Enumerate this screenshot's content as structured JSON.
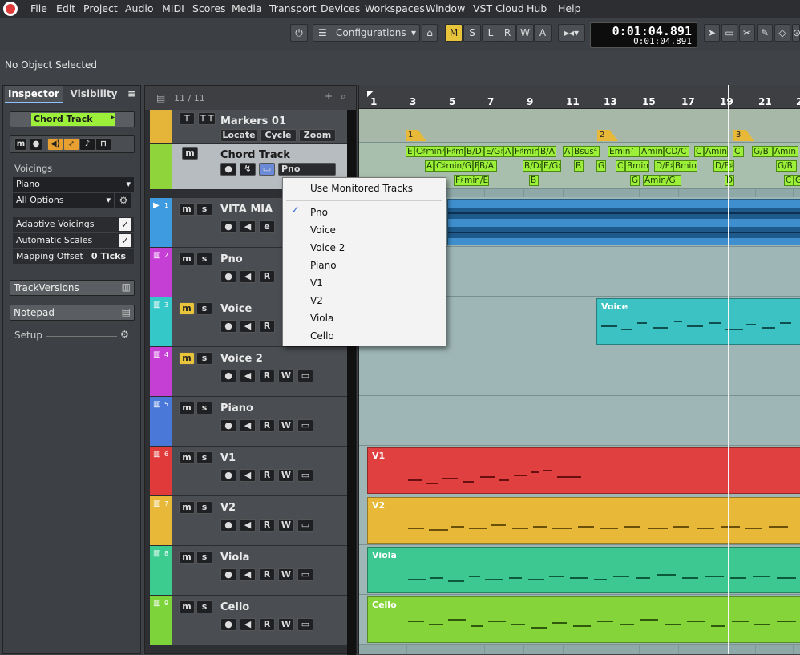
{
  "menubar": {
    "items": [
      "File",
      "Edit",
      "Project",
      "Audio",
      "MIDI",
      "Scores",
      "Media",
      "Transport",
      "Devices",
      "Workspaces",
      "Window",
      "VST Cloud",
      "Hub",
      "Help"
    ]
  },
  "toolbar": {
    "configurations_label": "Configurations",
    "mode_buttons": [
      "M",
      "S",
      "L",
      "R",
      "W",
      "A"
    ],
    "time_primary": "0:01:04.891",
    "time_secondary": "0:01:04.891"
  },
  "infoline": {
    "text": "No Object Selected"
  },
  "inspector": {
    "tabs": [
      "Inspector",
      "Visibility"
    ],
    "track_name": "Chord Track",
    "voicings_label": "Voicings",
    "voicing_value": "Piano",
    "options_value": "All Options",
    "adaptive_voicings": "Adaptive Voicings",
    "automatic_scales": "Automatic Scales",
    "mapping_offset_label": "Mapping Offset",
    "mapping_offset_value": "0 Ticks",
    "trackversions": "TrackVersions",
    "notepad": "Notepad",
    "setup": "Setup"
  },
  "tracklist": {
    "count": "11 / 11",
    "tracks": [
      {
        "num": "",
        "name": "Markers 01",
        "color": "#e5b53a",
        "buttons": [
          "Locate",
          "Cycle",
          "Zoom"
        ]
      },
      {
        "num": "",
        "name": "Chord Track",
        "color": "#8fd43a",
        "select": "Pno"
      },
      {
        "num": "1",
        "name": "VITA MIA",
        "color": "#3f9be0"
      },
      {
        "num": "2",
        "name": "Pno",
        "color": "#c63fd4"
      },
      {
        "num": "3",
        "name": "Voice",
        "color": "#35c8c8"
      },
      {
        "num": "4",
        "name": "Voice 2",
        "color": "#c63fd4"
      },
      {
        "num": "5",
        "name": "Piano",
        "color": "#4a78d8"
      },
      {
        "num": "6",
        "name": "V1",
        "color": "#e03a3a"
      },
      {
        "num": "7",
        "name": "V2",
        "color": "#e8b838"
      },
      {
        "num": "8",
        "name": "Viola",
        "color": "#3ccc90"
      },
      {
        "num": "9",
        "name": "Cello",
        "color": "#7cd43a"
      }
    ]
  },
  "ruler": [
    "1",
    "3",
    "5",
    "7",
    "9",
    "11",
    "13",
    "15",
    "17",
    "19",
    "21",
    "2"
  ],
  "markers": [
    "1",
    "2",
    "3"
  ],
  "chords": [
    "E",
    "C♯min⁷",
    "F♯min",
    "B/D♯",
    "E/G♯",
    "A",
    "F♯min",
    "B/A",
    "A",
    "Bsus⁴",
    "E",
    "Emin⁷",
    "Amin",
    "CD/C",
    "C",
    "Amin",
    "C",
    "G/B",
    "Amin",
    "A",
    "C♯min/G♯",
    "B",
    "B/A",
    "B/D♯",
    "E/G♯",
    "B",
    "G",
    "C",
    "Bmin",
    "D/F♯",
    "Bmin",
    "D/F♯",
    "G/B",
    "F♯min/E",
    "B",
    "G",
    "Amin/G",
    "D",
    "C",
    "G"
  ],
  "parts": [
    {
      "name": "Voice"
    },
    {
      "name": "V1"
    },
    {
      "name": "V2"
    },
    {
      "name": "Viola"
    },
    {
      "name": "Cello"
    }
  ],
  "dropdown": {
    "header": "Use Monitored Tracks",
    "items": [
      "Pno",
      "Voice",
      "Voice 2",
      "Piano",
      "V1",
      "V2",
      "Viola",
      "Cello"
    ],
    "checked": "Pno"
  }
}
